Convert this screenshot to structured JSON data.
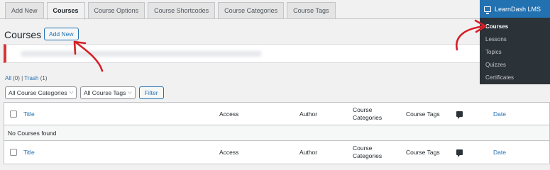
{
  "tabs": [
    {
      "label": "Add New",
      "active": false
    },
    {
      "label": "Courses",
      "active": true
    },
    {
      "label": "Course Options",
      "active": false
    },
    {
      "label": "Course Shortcodes",
      "active": false
    },
    {
      "label": "Course Categories",
      "active": false
    },
    {
      "label": "Course Tags",
      "active": false
    }
  ],
  "page": {
    "title": "Courses",
    "add_new_label": "Add New"
  },
  "views": {
    "all_label": "All",
    "all_count": "(0)",
    "separator": "|",
    "trash_label": "Trash",
    "trash_count": "(1)"
  },
  "filters": {
    "categories_selected": "All Course Categories",
    "tags_selected": "All Course Tags",
    "filter_button": "Filter"
  },
  "table": {
    "columns": {
      "title": "Title",
      "access": "Access",
      "author": "Author",
      "categories": "Course Categories",
      "tags": "Course Tags",
      "date": "Date"
    },
    "empty_message": "No Courses found"
  },
  "menu": {
    "title": "LearnDash LMS",
    "items": [
      "Courses",
      "Lessons",
      "Topics",
      "Quizzes",
      "Certificates"
    ],
    "current": "Courses"
  },
  "colors": {
    "accent": "#2271b1",
    "annotation_arrow": "#d61f26",
    "menu_bg": "#2c3338",
    "notice_border": "#d63638"
  },
  "icons": {
    "menu_header": "monitor-icon",
    "comments_column": "comment-bubble-icon"
  }
}
